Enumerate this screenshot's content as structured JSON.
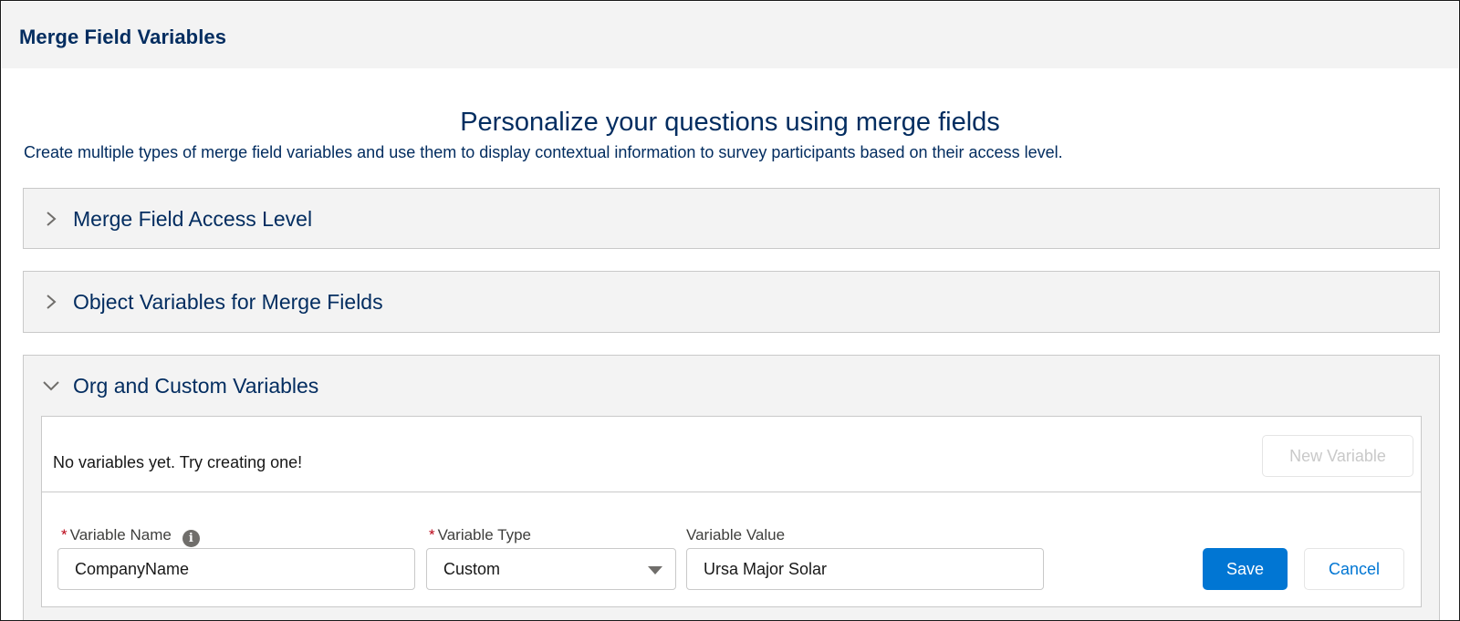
{
  "header": {
    "title": "Merge Field Variables"
  },
  "intro": {
    "heading": "Personalize your questions using merge fields",
    "description": "Create multiple types of merge field variables and use them to display contextual information to survey participants based on their access level."
  },
  "sections": [
    {
      "title": "Merge Field Access Level",
      "expanded": false,
      "icon": "chevron-right-icon"
    },
    {
      "title": "Object Variables for Merge Fields",
      "expanded": false,
      "icon": "chevron-right-icon"
    },
    {
      "title": "Org and Custom Variables",
      "expanded": true,
      "icon": "chevron-down-icon"
    }
  ],
  "custom_variables": {
    "empty_message": "No variables yet. Try creating one!",
    "new_variable_label": "New Variable",
    "form": {
      "required_marker": "*",
      "name_label": "Variable Name",
      "name_value": "CompanyName",
      "info_icon_glyph": "i",
      "type_label": "Variable Type",
      "type_value": "Custom",
      "value_label": "Variable Value",
      "value_value": "Ursa Major Solar",
      "save_label": "Save",
      "cancel_label": "Cancel"
    }
  },
  "colors": {
    "brand": "#0176d3",
    "heading_navy": "#032d60",
    "required": "#ba0517",
    "panel_bg": "#f3f3f3"
  }
}
